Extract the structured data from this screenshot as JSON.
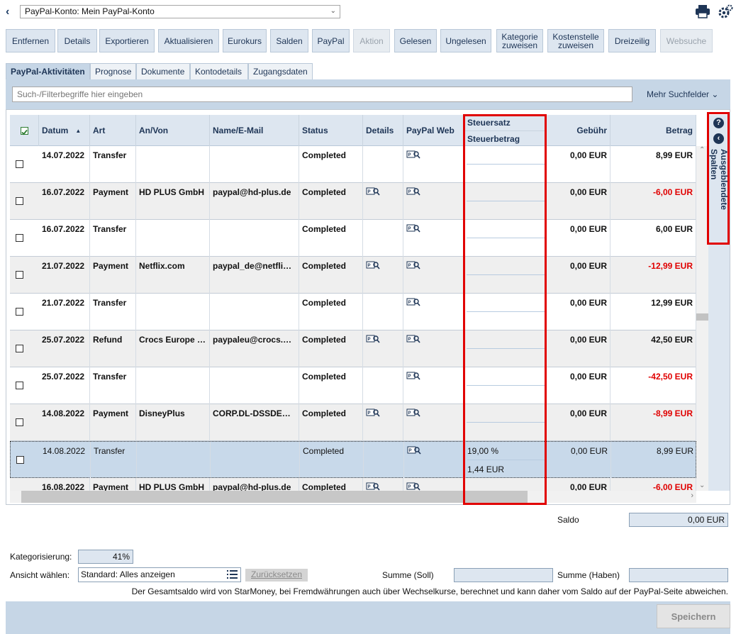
{
  "account": {
    "selected": "PayPal-Konto: Mein PayPal-Konto"
  },
  "toolbar": [
    {
      "label": "Entfernen",
      "enabled": true
    },
    {
      "label": "Details",
      "enabled": true
    },
    {
      "label": "Exportieren",
      "enabled": true
    },
    {
      "label": "Aktualisieren",
      "enabled": true
    },
    {
      "label": "Eurokurs",
      "enabled": true
    },
    {
      "label": "Salden",
      "enabled": true
    },
    {
      "label": "PayPal",
      "enabled": true
    },
    {
      "label": "Aktion",
      "enabled": false
    },
    {
      "label": "Gelesen",
      "enabled": true
    },
    {
      "label": "Ungelesen",
      "enabled": true
    },
    {
      "label": "Kategorie zuweisen",
      "enabled": true
    },
    {
      "label": "Kostenstelle zuweisen",
      "enabled": true
    },
    {
      "label": "Dreizeilig",
      "enabled": true
    },
    {
      "label": "Websuche",
      "enabled": false
    }
  ],
  "tabs": [
    {
      "label": "PayPal-Aktivitäten",
      "active": true
    },
    {
      "label": "Prognose",
      "active": false
    },
    {
      "label": "Dokumente",
      "active": false
    },
    {
      "label": "Kontodetails",
      "active": false
    },
    {
      "label": "Zugangsdaten",
      "active": false
    }
  ],
  "search": {
    "placeholder": "Such-/Filterbegriffe hier eingeben",
    "more_fields": "Mehr Suchfelder"
  },
  "table": {
    "columns": {
      "datum": "Datum",
      "art": "Art",
      "anvon": "An/Von",
      "email": "Name/E-Mail",
      "status": "Status",
      "details": "Details",
      "paypalweb": "PayPal Web",
      "steuersatz": "Steuersatz",
      "steuerbetrag": "Steuerbetrag",
      "gebuehr": "Gebühr",
      "betrag": "Betrag"
    },
    "rows": [
      {
        "datum": "14.07.2022",
        "art": "Transfer",
        "anvon": "",
        "email": "",
        "status": "Completed",
        "details_icon": false,
        "steuersatz": "",
        "steuerbetrag": "",
        "gebuehr": "0,00 EUR",
        "betrag": "8,99 EUR",
        "negative": false,
        "selected": false
      },
      {
        "datum": "16.07.2022",
        "art": "Payment",
        "anvon": "HD PLUS GmbH",
        "email": "paypal@hd-plus.de",
        "status": "Completed",
        "details_icon": true,
        "steuersatz": "",
        "steuerbetrag": "",
        "gebuehr": "0,00 EUR",
        "betrag": "-6,00 EUR",
        "negative": true,
        "selected": false
      },
      {
        "datum": "16.07.2022",
        "art": "Transfer",
        "anvon": "",
        "email": "",
        "status": "Completed",
        "details_icon": false,
        "steuersatz": "",
        "steuerbetrag": "",
        "gebuehr": "0,00 EUR",
        "betrag": "6,00 EUR",
        "negative": false,
        "selected": false
      },
      {
        "datum": "21.07.2022",
        "art": "Payment",
        "anvon": "Netflix.com",
        "email": "paypal_de@netflix....",
        "status": "Completed",
        "details_icon": true,
        "steuersatz": "",
        "steuerbetrag": "",
        "gebuehr": "0,00 EUR",
        "betrag": "-12,99 EUR",
        "negative": true,
        "selected": false
      },
      {
        "datum": "21.07.2022",
        "art": "Transfer",
        "anvon": "",
        "email": "",
        "status": "Completed",
        "details_icon": false,
        "steuersatz": "",
        "steuerbetrag": "",
        "gebuehr": "0,00 EUR",
        "betrag": "12,99 EUR",
        "negative": false,
        "selected": false
      },
      {
        "datum": "25.07.2022",
        "art": "Refund",
        "anvon": "Crocs Europe B...",
        "email": "paypaleu@crocs.com",
        "status": "Completed",
        "details_icon": true,
        "steuersatz": "",
        "steuerbetrag": "",
        "gebuehr": "0,00 EUR",
        "betrag": "42,50 EUR",
        "negative": false,
        "selected": false
      },
      {
        "datum": "25.07.2022",
        "art": "Transfer",
        "anvon": "",
        "email": "",
        "status": "Completed",
        "details_icon": false,
        "steuersatz": "",
        "steuerbetrag": "",
        "gebuehr": "0,00 EUR",
        "betrag": "-42,50 EUR",
        "negative": true,
        "selected": false
      },
      {
        "datum": "14.08.2022",
        "art": "Payment",
        "anvon": "DisneyPlus",
        "email": "CORP.DL-DSSDE@...",
        "status": "Completed",
        "details_icon": true,
        "steuersatz": "",
        "steuerbetrag": "",
        "gebuehr": "0,00 EUR",
        "betrag": "-8,99 EUR",
        "negative": true,
        "selected": false
      },
      {
        "datum": "14.08.2022",
        "art": "Transfer",
        "anvon": "",
        "email": "",
        "status": "Completed",
        "details_icon": false,
        "steuersatz": "19,00 %",
        "steuerbetrag": "1,44 EUR",
        "gebuehr": "0,00 EUR",
        "betrag": "8,99 EUR",
        "negative": false,
        "selected": true
      },
      {
        "datum": "16.08.2022",
        "art": "Payment",
        "anvon": "HD PLUS GmbH",
        "email": "paypal@hd-plus.de",
        "status": "Completed",
        "details_icon": true,
        "steuersatz": "",
        "steuerbetrag": "",
        "gebuehr": "0,00 EUR",
        "betrag": "-6,00 EUR",
        "negative": true,
        "selected": false
      }
    ]
  },
  "side": {
    "hidden_columns_label": "Ausgeblendete Spalten"
  },
  "footer": {
    "saldo_label": "Saldo",
    "saldo_value": "0,00 EUR",
    "kategorisierung_label": "Kategorisierung:",
    "kategorisierung_value": "41%",
    "ansicht_label": "Ansicht wählen:",
    "ansicht_value": "Standard: Alles anzeigen",
    "reset_label": "Zurücksetzen",
    "soll_label": "Summe (Soll)",
    "soll_value": "",
    "haben_label": "Summe (Haben)",
    "haben_value": "",
    "note": "Der Gesamtsaldo wird von StarMoney, bei Fremdwährungen auch über Wechselkurse, berechnet und kann daher vom Saldo auf der PayPal-Seite abweichen.",
    "save_label": "Speichern"
  },
  "colors": {
    "accent": "#1e3556",
    "negative": "#e00000",
    "highlight": "#e10000",
    "header_bg": "#dde6f0"
  }
}
